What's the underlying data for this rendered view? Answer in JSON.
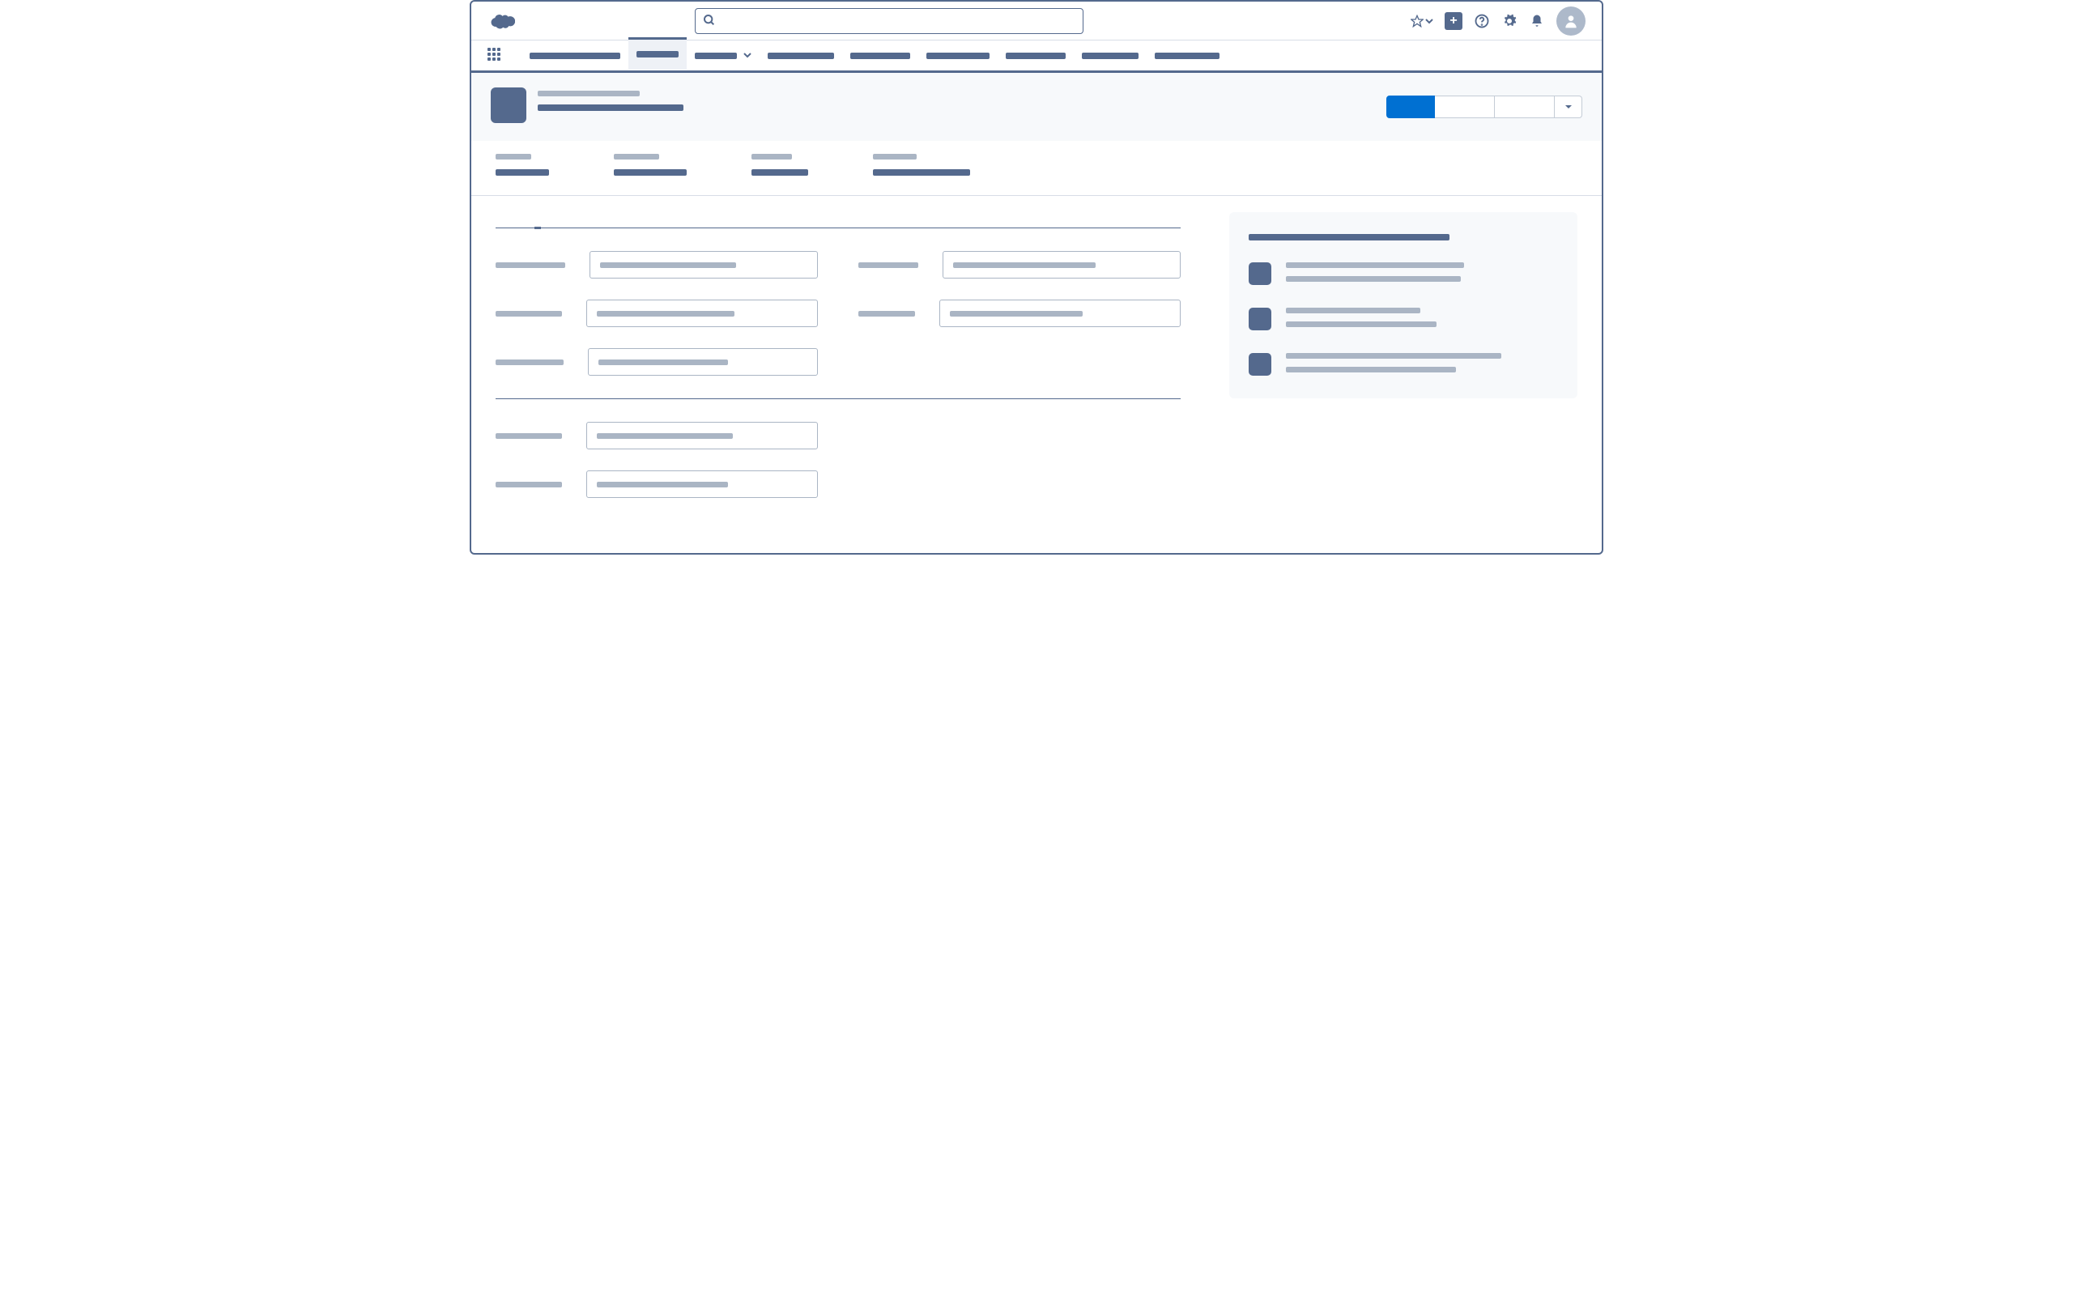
{
  "globalHeader": {
    "searchPlaceholder": ""
  },
  "nav": {
    "items": [
      {
        "w": 112
      },
      {
        "w": 52,
        "active": true
      },
      {
        "w": 52,
        "dropdown": true
      },
      {
        "w": 82
      },
      {
        "w": 74
      },
      {
        "w": 78
      },
      {
        "w": 74
      },
      {
        "w": 70
      },
      {
        "w": 80
      }
    ]
  },
  "recordHeader": {
    "title_w": 126,
    "subtitle_w": 180,
    "actions": [
      "primary",
      "secondary",
      "secondary",
      "dropdown"
    ]
  },
  "highlights": [
    {
      "label_w": 44,
      "value_w": 66
    },
    {
      "label_w": 56,
      "value_w": 90
    },
    {
      "label_w": 50,
      "value_w": 70
    },
    {
      "label_w": 54,
      "value_w": 120
    }
  ],
  "tabs": [
    {
      "w": 76,
      "active": false
    },
    {
      "w": 82,
      "active": true
    },
    {
      "w": 78,
      "active": false
    }
  ],
  "formSection1": [
    {
      "label_w": 86,
      "value_w": 168,
      "col": 1
    },
    {
      "label_w": 74,
      "value_w": 176,
      "col": 2
    },
    {
      "label_w": 82,
      "value_w": 170,
      "col": 1
    },
    {
      "label_w": 70,
      "value_w": 164,
      "col": 2
    },
    {
      "label_w": 84,
      "value_w": 160,
      "col": 1
    }
  ],
  "formSection2": [
    {
      "label_w": 82,
      "value_w": 168,
      "col": 1
    },
    {
      "label_w": 82,
      "value_w": 162,
      "col": 1
    }
  ],
  "sidePanel": {
    "title_w": 248,
    "items": [
      {
        "line1_w": 220,
        "line2_w": 216
      },
      {
        "line1_w": 166,
        "line2_w": 186
      },
      {
        "line1_w": 266,
        "line2_w": 210
      }
    ]
  }
}
